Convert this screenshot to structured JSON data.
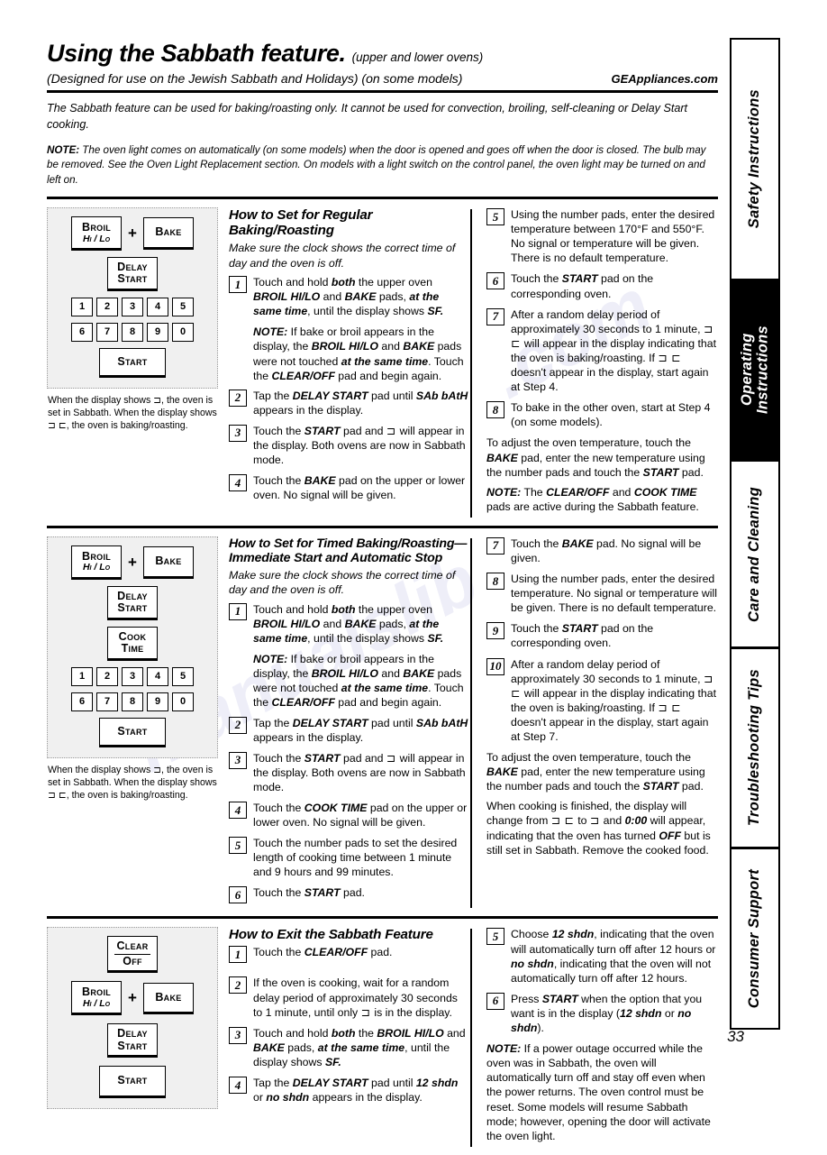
{
  "header": {
    "title": "Using the Sabbath feature.",
    "title_suffix": "(upper and lower ovens)",
    "subtitle": "(Designed for use on the Jewish Sabbath and Holidays)  (on some models)",
    "website": "GEAppliances.com",
    "intro": "The Sabbath feature can be used for baking/roasting only. It cannot be used for convection, broiling, self-cleaning or Delay Start cooking.",
    "note_label": "NOTE:",
    "note_text": " The oven light comes on automatically (on some models) when the door is opened and goes off when the door is closed. The bulb may be removed. See the Oven Light Replacement section. On models with a light switch on the control panel, the oven light may be turned on and left on."
  },
  "tabs": [
    {
      "label": "Safety Instructions",
      "active": false
    },
    {
      "label": "Operating\nInstructions",
      "active": true
    },
    {
      "label": "Care and Cleaning",
      "active": false
    },
    {
      "label": "Troubleshooting Tips",
      "active": false
    },
    {
      "label": "Consumer Support",
      "active": false
    }
  ],
  "keys": {
    "broil_1": "Broil",
    "broil_2": "Hi / Lo",
    "bake": "Bake",
    "delay_1": "Delay",
    "delay_2": "Start",
    "cook_1": "Cook",
    "cook_2": "Time",
    "start": "Start",
    "clear_1": "Clear",
    "clear_2": "Off",
    "plus": "+",
    "numbers_top": [
      "1",
      "2",
      "3",
      "4",
      "5"
    ],
    "numbers_bottom": [
      "6",
      "7",
      "8",
      "9",
      "0"
    ]
  },
  "panel_caption": "When the display shows ⊐, the oven is set in Sabbath. When the display shows ⊐ ⊏, the oven is baking/roasting.",
  "section1": {
    "heading": "How to Set for Regular Baking/Roasting",
    "lead": "Make sure the clock shows the correct time of day and the oven is off.",
    "steps_left": [
      {
        "n": "1",
        "text": "Touch and hold both the upper oven BROIL HI/LO and BAKE pads, at the same time, until the display shows SF."
      },
      {
        "n": "2",
        "text": "Tap the DELAY START pad until SAb bAtH appears in the display."
      },
      {
        "n": "3",
        "text": "Touch the START pad and ⊐ will appear in the display. Both ovens are now in Sabbath mode."
      },
      {
        "n": "4",
        "text": "Touch the BAKE pad on the upper or lower oven. No signal will be given."
      }
    ],
    "step1_note": "NOTE: If bake or broil appears in the display, the BROIL HI/LO and BAKE pads were not touched at the same time. Touch the CLEAR/OFF pad and begin again.",
    "steps_right": [
      {
        "n": "5",
        "text": "Using the number pads, enter the desired temperature between 170°F and 550°F. No signal or temperature will be given. There is no default temperature."
      },
      {
        "n": "6",
        "text": "Touch the START pad on the corresponding oven."
      },
      {
        "n": "7",
        "text": "After a random delay period of approximately 30 seconds to 1 minute, ⊐ ⊏ will appear in the display indicating that the oven is baking/roasting. If ⊐ ⊏ doesn't appear in the display, start again at Step 4."
      },
      {
        "n": "8",
        "text": "To bake in the other oven, start at Step 4 (on some models)."
      }
    ],
    "adjust_para": "To adjust the oven temperature, touch the BAKE pad, enter the new temperature using the number pads and touch the START pad.",
    "final_note": "NOTE: The CLEAR/OFF and COOK TIME pads are active during the Sabbath feature."
  },
  "section2": {
    "heading": "How to Set for Timed Baking/Roasting—Immediate Start and Automatic Stop",
    "lead": "Make sure the clock shows the correct time of day and the oven is off.",
    "steps_left": [
      {
        "n": "1",
        "text": "Touch and hold both the upper oven BROIL HI/LO and BAKE pads, at the same time, until the display shows SF."
      },
      {
        "n": "2",
        "text": "Tap the DELAY START pad until SAb bAtH appears in the display."
      },
      {
        "n": "3",
        "text": "Touch the START pad and ⊐ will appear in the display. Both ovens are now in Sabbath mode."
      },
      {
        "n": "4",
        "text": "Touch the COOK TIME pad on the upper or lower oven. No signal will be given."
      },
      {
        "n": "5",
        "text": "Touch the number pads to set the desired length of cooking time between 1 minute and 9 hours and 99 minutes."
      },
      {
        "n": "6",
        "text": "Touch the START pad."
      }
    ],
    "step1_note": "NOTE: If bake or broil appears in the display, the BROIL HI/LO and BAKE pads were not touched at the same time. Touch the CLEAR/OFF pad and begin again.",
    "steps_right": [
      {
        "n": "7",
        "text": "Touch the BAKE pad. No signal will be given."
      },
      {
        "n": "8",
        "text": "Using the number pads, enter the desired temperature. No signal or temperature will be given. There is no default temperature."
      },
      {
        "n": "9",
        "text": "Touch the START pad on the corresponding oven."
      },
      {
        "n": "10",
        "text": "After a random delay period of approximately 30 seconds to 1 minute, ⊐ ⊏ will appear in the display indicating that the oven is baking/roasting. If ⊐ ⊏ doesn't appear in the display, start again at Step 7."
      }
    ],
    "adjust_para": "To adjust the oven temperature, touch the BAKE pad, enter the new temperature using the number pads and touch the START pad.",
    "finish_para": "When cooking is finished, the display will change from ⊐ ⊏ to ⊐ and 0:00 will appear, indicating that the oven has turned OFF but is still set in Sabbath. Remove the cooked food."
  },
  "section3": {
    "heading": "How to Exit the Sabbath Feature",
    "steps_left": [
      {
        "n": "1",
        "text": "Touch the CLEAR/OFF pad."
      },
      {
        "n": "2",
        "text": "If the oven is cooking, wait for a random delay period of approximately 30 seconds to 1 minute, until only ⊐ is in the display."
      },
      {
        "n": "3",
        "text": "Touch and hold both the BROIL HI/LO and BAKE pads, at the same time, until the display shows SF."
      },
      {
        "n": "4",
        "text": "Tap the DELAY START pad until 12 shdn or no shdn appears in the display."
      }
    ],
    "steps_right": [
      {
        "n": "5",
        "text": "Choose 12 shdn, indicating that the oven will automatically turn off after 12 hours or no shdn, indicating that the oven will not automatically turn off after 12 hours."
      },
      {
        "n": "6",
        "text": "Press START when the option that you want is in the display (12 shdn or no shdn)."
      }
    ],
    "final_note": "NOTE: If a power outage occurred while the oven was in Sabbath, the oven will automatically turn off and stay off even when the power returns. The oven control must be reset. Some models will resume Sabbath mode; however, opening the door will activate the oven light."
  },
  "page_number": "33"
}
